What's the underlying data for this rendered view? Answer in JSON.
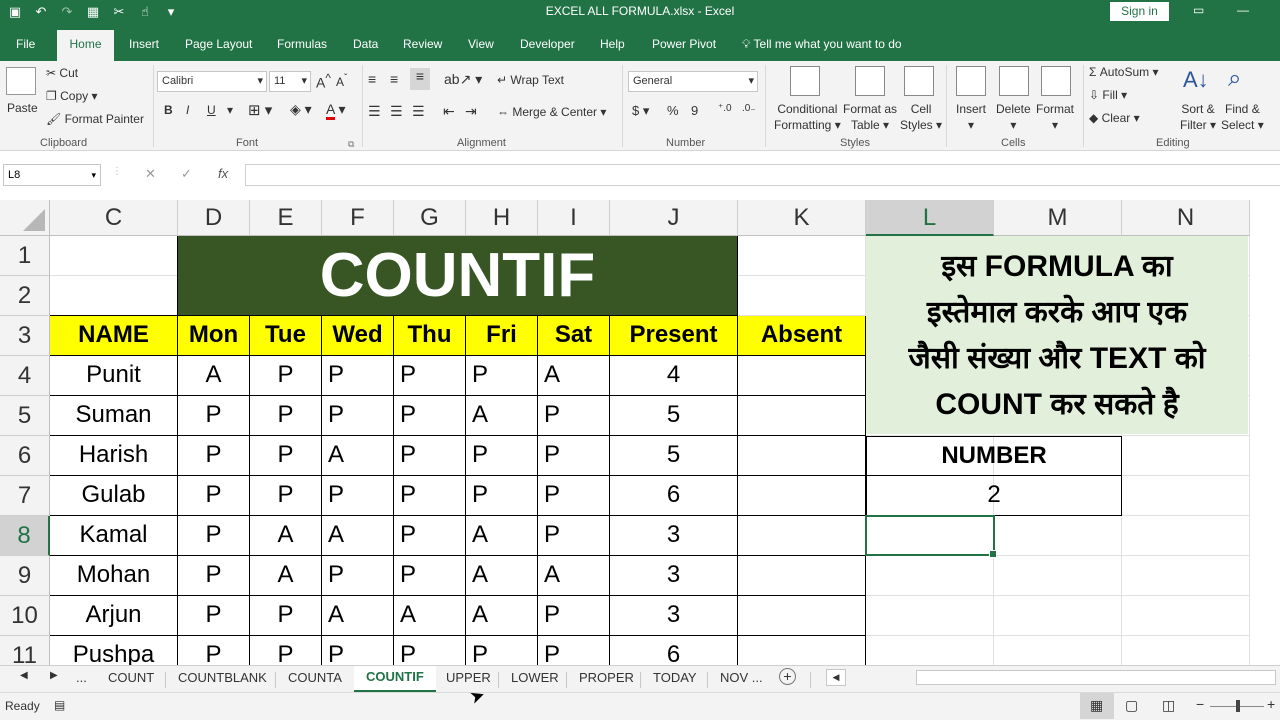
{
  "app": {
    "window_title": "EXCEL ALL FORMULA.xlsx  -  Excel",
    "sign_in": "Sign in"
  },
  "qat": {
    "save_icon": "save-icon",
    "undo_icon": "undo-icon",
    "redo_icon": "redo-icon",
    "calc_icon": "calculator-icon",
    "cut_icon": "scissors-icon",
    "touch_icon": "touch-mode-icon"
  },
  "tabs": [
    "File",
    "Home",
    "Insert",
    "Page Layout",
    "Formulas",
    "Data",
    "Review",
    "View",
    "Developer",
    "Help",
    "Power Pivot",
    "Tell me what you want to do"
  ],
  "ribbon": {
    "clipboard": {
      "paste": "Paste",
      "cut": "Cut",
      "copy": "Copy",
      "format_painter": "Format Painter",
      "group": "Clipboard"
    },
    "font": {
      "name": "Calibri",
      "size": "11",
      "bold": "B",
      "italic": "I",
      "underline": "U",
      "font_color_letter": "A",
      "group": "Font"
    },
    "alignment": {
      "wrap_text": "Wrap Text",
      "merge_center": "Merge & Center",
      "group": "Alignment"
    },
    "number": {
      "format": "General",
      "percent": "%",
      "comma": "9",
      "group": "Number"
    },
    "styles": {
      "conditional": [
        "Conditional",
        "Formatting"
      ],
      "format_table": [
        "Format as",
        "Table"
      ],
      "cell_styles": [
        "Cell",
        "Styles"
      ],
      "group": "Styles"
    },
    "cells": {
      "insert": "Insert",
      "delete": "Delete",
      "format": "Format",
      "group": "Cells"
    },
    "editing": {
      "autosum": "AutoSum",
      "fill": "Fill",
      "clear": "Clear",
      "sort_filter": [
        "Sort &",
        "Filter"
      ],
      "find_select": [
        "Find &",
        "Select"
      ],
      "group": "Editing"
    }
  },
  "formula_bar": {
    "name_box": "L8",
    "cancel": "✕",
    "enter": "✓",
    "fx": "fx",
    "value": ""
  },
  "columns": [
    "C",
    "D",
    "E",
    "F",
    "G",
    "H",
    "I",
    "J",
    "K",
    "L",
    "M",
    "N"
  ],
  "rows": [
    "1",
    "2",
    "3",
    "4",
    "5",
    "6",
    "7",
    "8",
    "9",
    "10",
    "11"
  ],
  "sheet": {
    "banner": "COUNTIF",
    "headers": [
      "NAME",
      "Mon",
      "Tue",
      "Wed",
      "Thu",
      "Fri",
      "Sat",
      "Present",
      "Absent"
    ],
    "data": [
      [
        "Punit",
        "A",
        "P",
        "P",
        "P",
        "P",
        "A",
        "4"
      ],
      [
        "Suman",
        "P",
        "P",
        "P",
        "P",
        "A",
        "P",
        "5"
      ],
      [
        "Harish",
        "P",
        "P",
        "A",
        "P",
        "P",
        "P",
        "5"
      ],
      [
        "Gulab",
        "P",
        "P",
        "P",
        "P",
        "P",
        "P",
        "6"
      ],
      [
        "Kamal",
        "P",
        "A",
        "A",
        "P",
        "A",
        "P",
        "3"
      ],
      [
        "Mohan",
        "P",
        "A",
        "P",
        "P",
        "A",
        "A",
        "3"
      ],
      [
        "Arjun",
        "P",
        "P",
        "A",
        "A",
        "A",
        "P",
        "3"
      ],
      [
        "Pushpa",
        "P",
        "P",
        "P",
        "P",
        "P",
        "P",
        "6"
      ]
    ],
    "note_lines": [
      "इस FORMULA का",
      "इस्तेमाल करके आप एक",
      "जैसी संख्या और TEXT को",
      "COUNT कर सकते है"
    ],
    "number_label": "NUMBER",
    "number_value": "2"
  },
  "sheet_tabs": {
    "ellipsis": "...",
    "tabs": [
      "COUNT",
      "COUNTBLANK",
      "COUNTA",
      "COUNTIF",
      "UPPER",
      "LOWER",
      "PROPER",
      "TODAY",
      "NOV ..."
    ],
    "active": "COUNTIF"
  },
  "status": {
    "ready": "Ready",
    "zoom_minus": "−",
    "zoom_plus": "+"
  }
}
